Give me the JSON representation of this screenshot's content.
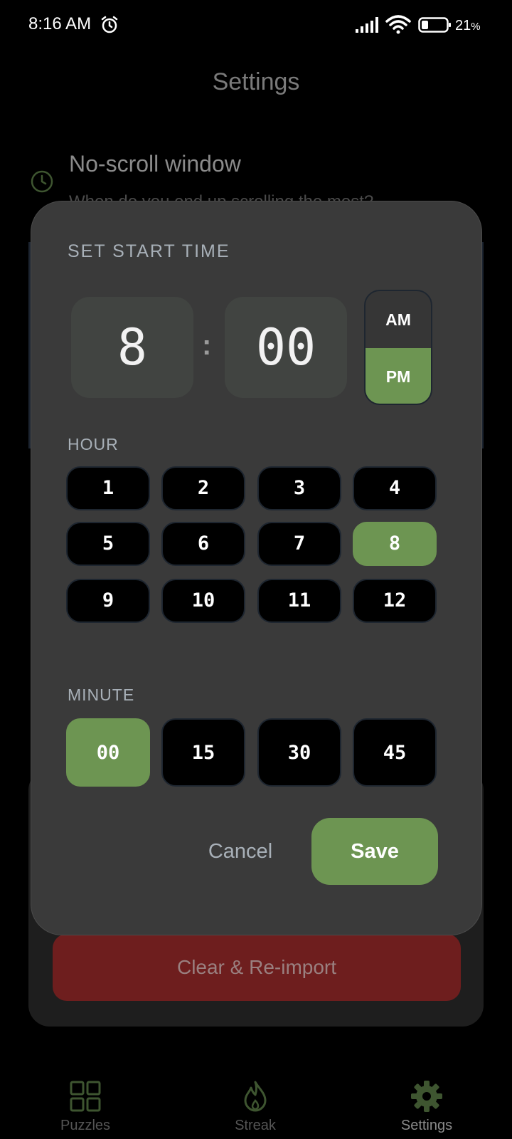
{
  "status_bar": {
    "time": "8:16 AM",
    "battery": "21",
    "battery_unit": "%"
  },
  "background": {
    "title": "Settings",
    "section_title": "No-scroll window",
    "section_subtitle": "When do you end up scrolling the most?",
    "clear_button": "Clear & Re-import"
  },
  "bottom_nav": {
    "puzzles": "Puzzles",
    "streak": "Streak",
    "settings": "Settings"
  },
  "modal": {
    "heading": "SET START TIME",
    "hour_value": "8",
    "separator": ":",
    "minute_value": "00",
    "am_label": "AM",
    "pm_label": "PM",
    "selected_period": "PM",
    "hour_label": "HOUR",
    "hours": [
      "1",
      "2",
      "3",
      "4",
      "5",
      "6",
      "7",
      "8",
      "9",
      "10",
      "11",
      "12"
    ],
    "selected_hour": "8",
    "minute_label": "MINUTE",
    "minutes": [
      "00",
      "15",
      "30",
      "45"
    ],
    "selected_minute": "00",
    "cancel": "Cancel",
    "save": "Save"
  },
  "colors": {
    "accent": "#6d9552",
    "danger": "#6e1e1e",
    "modal_bg": "#3a3a3a"
  }
}
